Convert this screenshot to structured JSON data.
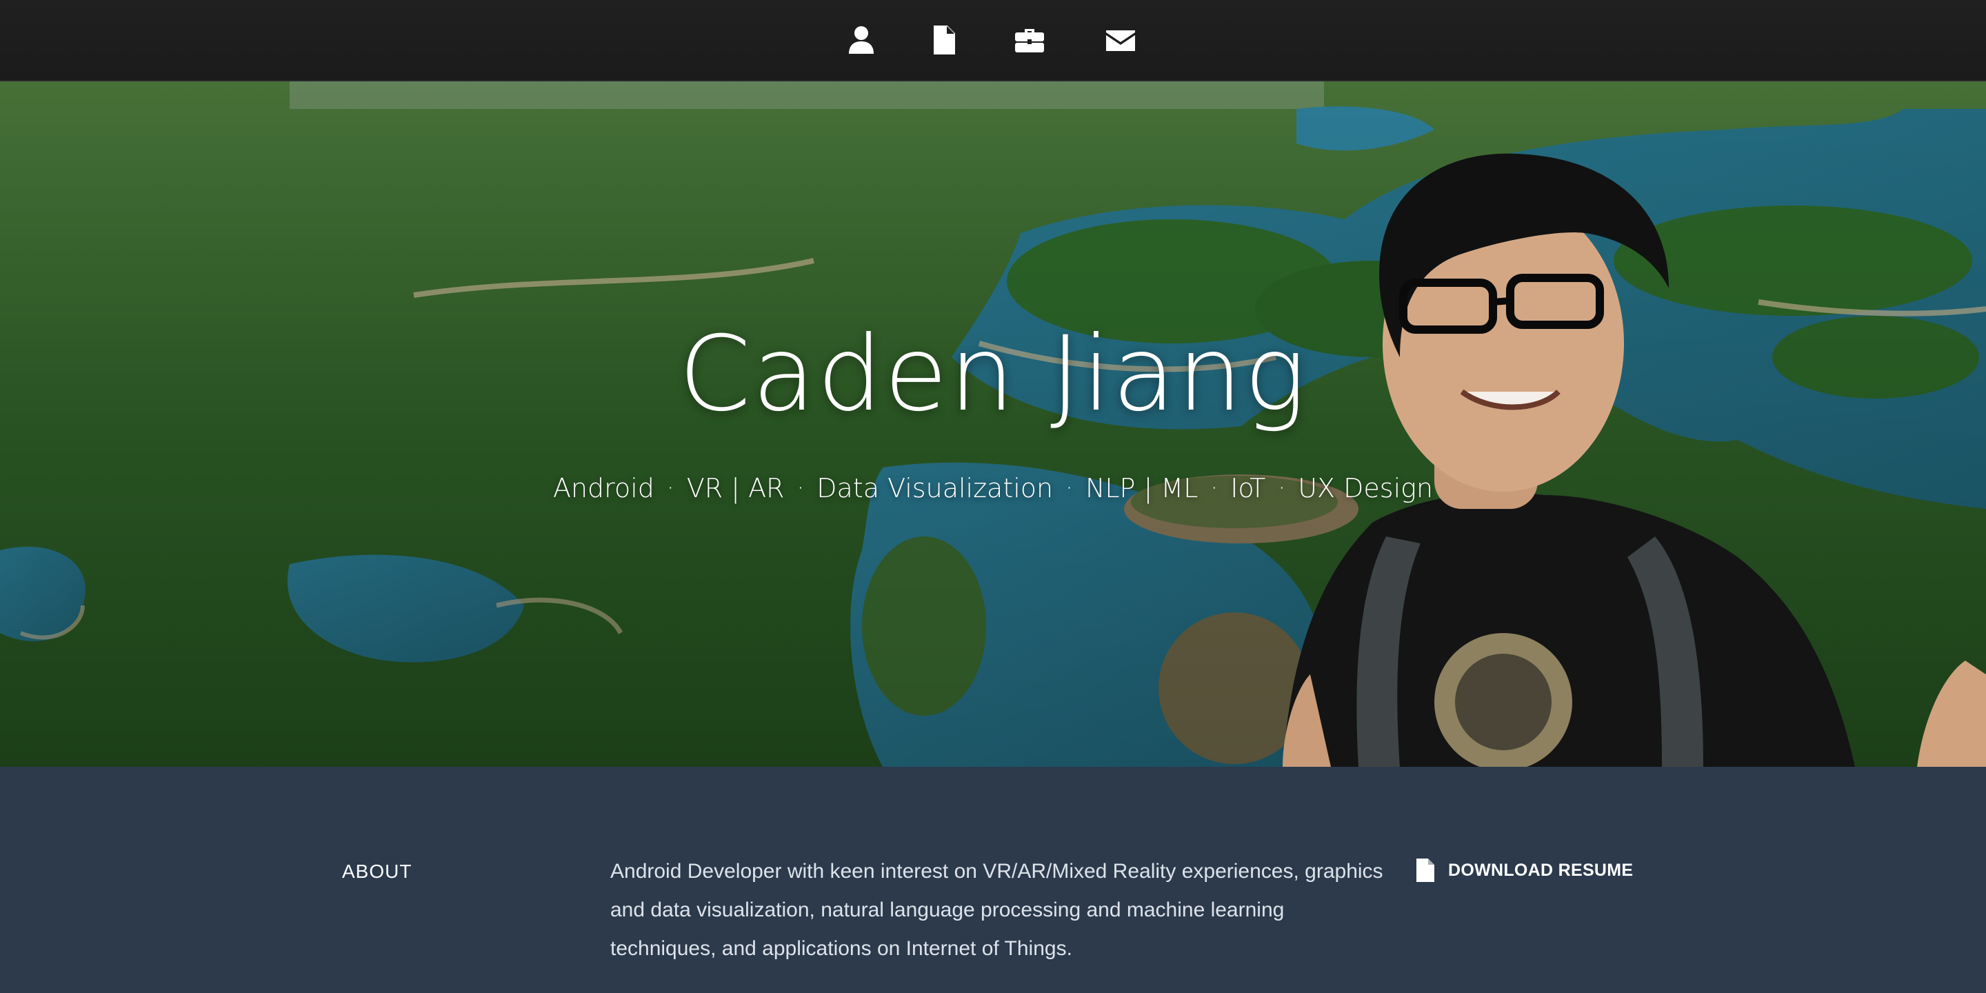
{
  "nav": {
    "items": [
      {
        "icon": "user-icon",
        "target": "about"
      },
      {
        "icon": "file-icon",
        "target": "resume"
      },
      {
        "icon": "briefcase-icon",
        "target": "work"
      },
      {
        "icon": "envelope-icon",
        "target": "contact"
      }
    ]
  },
  "hero": {
    "title": "Caden Jiang",
    "tags": [
      "Android",
      "VR | AR",
      "Data Visualization",
      "NLP | ML",
      "IoT",
      "UX Design"
    ],
    "separator": "·"
  },
  "about": {
    "heading": "ABOUT",
    "body": "Android Developer with keen interest on VR/AR/Mixed Reality experiences, graphics and data visualization, natural language processing and machine learning techniques, and applications on Internet of Things.",
    "download": {
      "label": "DOWNLOAD RESUME",
      "icon": "file-icon"
    }
  },
  "colors": {
    "navbar": "#1c1c1c",
    "about_bg": "#2c3a4c",
    "text": "#ffffff"
  }
}
